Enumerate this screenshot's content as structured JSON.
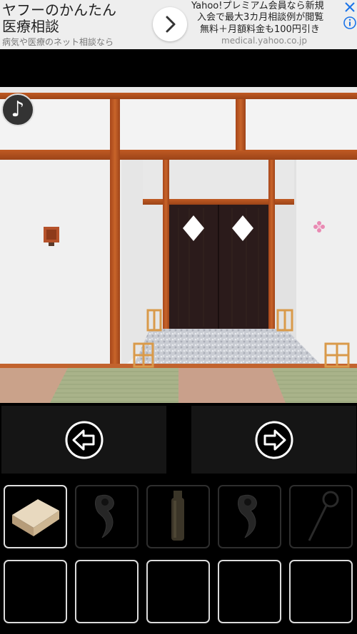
{
  "ad": {
    "title_line1": "ヤフーのかんたん",
    "title_line2": "医療相談",
    "subtitle": "病気や医療のネット相談なら",
    "right_line1": "Yahoo!プレミアム会員なら新規",
    "right_line2": "入会で最大3カ月相談例が閲覧",
    "right_line3": "無料＋月額料金も100円引き",
    "url": "medical.yahoo.co.jp"
  },
  "scene": {
    "room": "japanese-corridor",
    "music_symbol": "♪"
  },
  "navigation": {
    "left_icon": "arrow-left-icon",
    "right_icon": "arrow-right-icon"
  },
  "inventory": {
    "selected_index": 0,
    "slots": [
      {
        "item": "wooden-box",
        "icon": "box-icon"
      },
      {
        "item": "hook",
        "icon": "hook-icon"
      },
      {
        "item": "bottle",
        "icon": "bottle-icon"
      },
      {
        "item": "hook",
        "icon": "hook-icon"
      },
      {
        "item": "magnifying-wand",
        "icon": "wand-icon"
      },
      {
        "item": "",
        "icon": ""
      },
      {
        "item": "",
        "icon": ""
      },
      {
        "item": "",
        "icon": ""
      },
      {
        "item": "",
        "icon": ""
      },
      {
        "item": "",
        "icon": ""
      }
    ]
  },
  "colors": {
    "wood": "#b5501f",
    "door": "#2a1a1a",
    "wall": "#f2f2f2",
    "tatami": "#a8b38a"
  }
}
